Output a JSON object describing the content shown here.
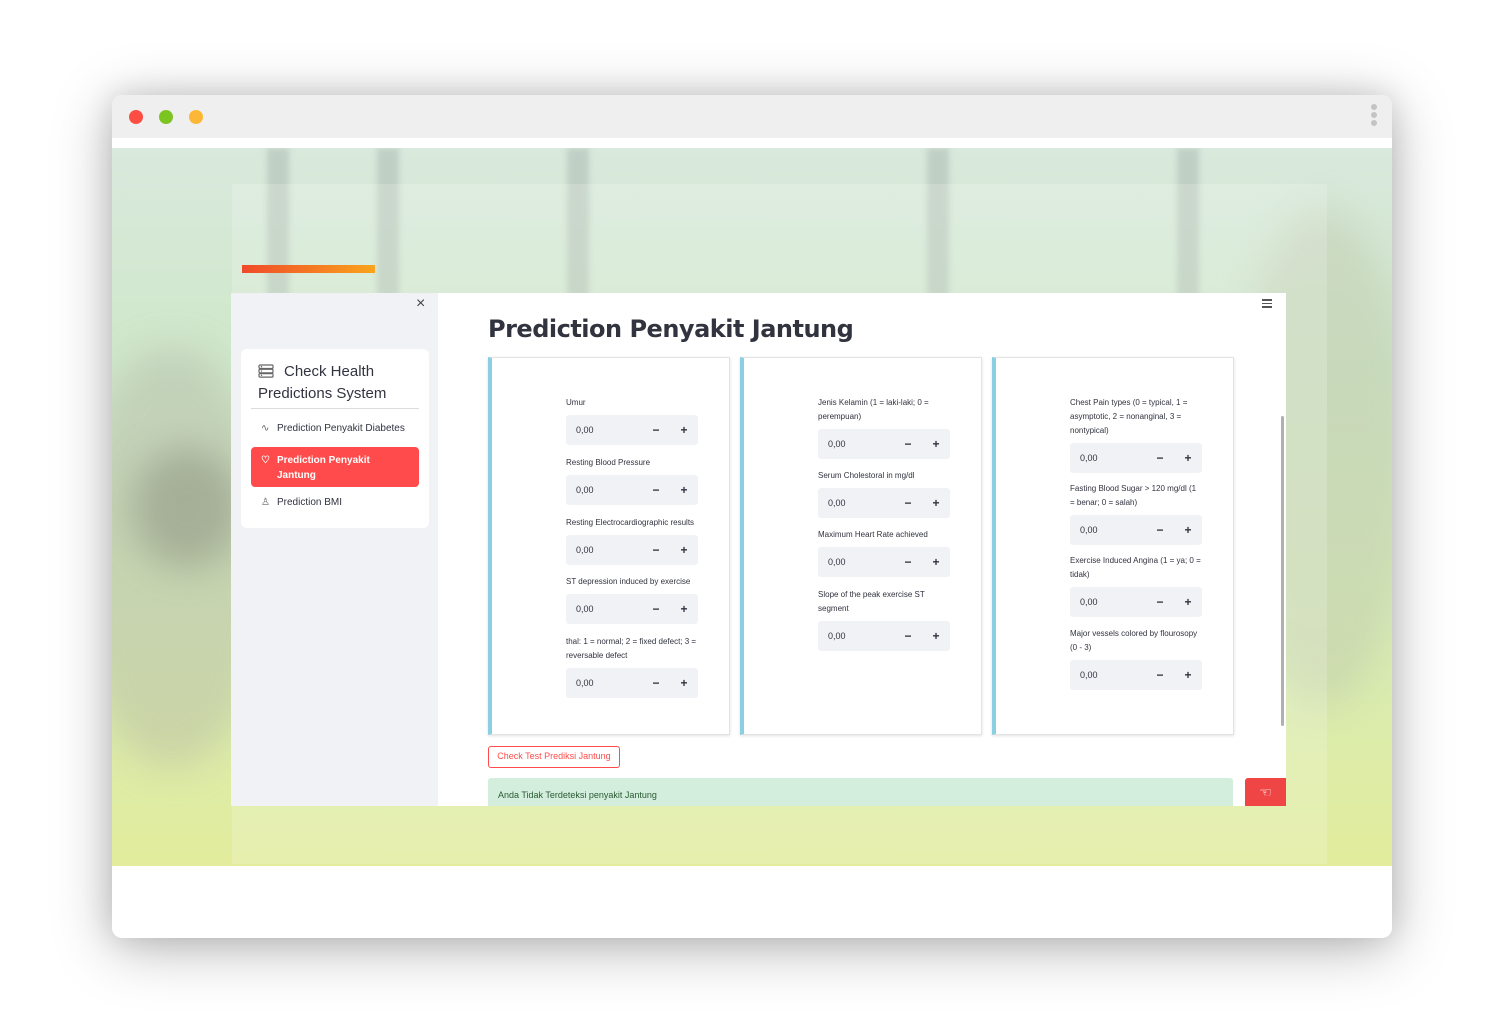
{
  "sidebar": {
    "header_line1": "Check Health",
    "header_line2": "Predictions System",
    "close_glyph": "×",
    "items": [
      {
        "label": "Prediction Penyakit Diabetes",
        "icon": "activity-icon",
        "glyph": "∿"
      },
      {
        "label": "Prediction Penyakit Jantung",
        "icon": "heart-icon",
        "glyph": "♡",
        "active": true
      },
      {
        "label": "Prediction BMI",
        "icon": "person-icon",
        "glyph": "♙"
      }
    ]
  },
  "main": {
    "title": "Prediction Penyakit Jantung",
    "columns": [
      {
        "fields": [
          {
            "label": "Umur",
            "value": "0,00"
          },
          {
            "label": "Resting Blood Pressure",
            "value": "0,00"
          },
          {
            "label": "Resting Electrocardiographic results",
            "value": "0,00"
          },
          {
            "label": "ST depression induced by exercise",
            "value": "0,00"
          },
          {
            "label": "thal: 1 = normal; 2 = fixed defect; 3 = reversable defect",
            "value": "0,00"
          }
        ]
      },
      {
        "fields": [
          {
            "label": "Jenis Kelamin (1 = laki-laki; 0 = perempuan)",
            "value": "0,00"
          },
          {
            "label": "Serum Cholestoral in mg/dl",
            "value": "0,00"
          },
          {
            "label": "Maximum Heart Rate achieved",
            "value": "0,00"
          },
          {
            "label": "Slope of the peak exercise ST segment",
            "value": "0,00"
          }
        ]
      },
      {
        "fields": [
          {
            "label": "Chest Pain types (0 = typical, 1 = asymptotic, 2 = nonanginal, 3 = nontypical)",
            "value": "0,00"
          },
          {
            "label": "Fasting Blood Sugar > 120 mg/dl (1 = benar; 0 = salah)",
            "value": "0,00"
          },
          {
            "label": "Exercise Induced Angina (1 = ya; 0 = tidak)",
            "value": "0,00"
          },
          {
            "label": "Major vessels colored by flourosopy (0 - 3)",
            "value": "0,00"
          }
        ]
      }
    ],
    "stepper_minus": "−",
    "stepper_plus": "+",
    "check_button": "Check Test Prediksi Jantung",
    "result_text": "Anda Tidak Terdeteksi penyakit Jantung"
  },
  "colors": {
    "accent": "#ff4b4b",
    "panel_border": "#8ccfe0",
    "result_bg": "#d3eedc"
  }
}
